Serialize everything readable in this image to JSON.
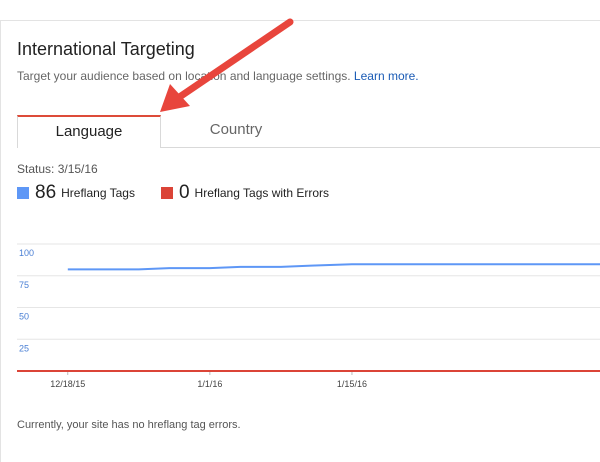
{
  "header": {
    "title": "International Targeting",
    "subtitle": "Target your audience based on location and language settings.",
    "learn_more": "Learn more."
  },
  "tabs": [
    {
      "label": "Language",
      "active": true
    },
    {
      "label": "Country",
      "active": false
    }
  ],
  "status": "Status: 3/15/16",
  "legend": [
    {
      "count": "86",
      "label": "Hreflang Tags",
      "color": "#5e97f6"
    },
    {
      "count": "0",
      "label": "Hreflang Tags with Errors",
      "color": "#db4437"
    }
  ],
  "chart_data": {
    "type": "line",
    "ylim": [
      0,
      100
    ],
    "yticks": [
      "100",
      "75",
      "50",
      "25"
    ],
    "xticks": [
      "12/18/15",
      "1/1/16",
      "1/15/16"
    ],
    "grid": true,
    "series": [
      {
        "name": "Hreflang Tags",
        "color": "#5e97f6",
        "x": [
          "12/18/15",
          "12/21/15",
          "12/25/15",
          "12/28/15",
          "1/1/16",
          "1/4/16",
          "1/8/16",
          "1/11/16",
          "1/15/16",
          "1/18/16",
          "1/22/16",
          "1/26/16"
        ],
        "values": [
          80,
          80,
          80,
          81,
          81,
          82,
          82,
          83,
          84,
          84,
          84,
          84
        ]
      },
      {
        "name": "Hreflang Tags with Errors",
        "color": "#db4437",
        "x": [
          "12/18/15",
          "1/26/16"
        ],
        "values": [
          0,
          0
        ]
      }
    ]
  },
  "footer": "Currently, your site has no hreflang tag errors.",
  "annotation": {
    "color": "#e8453c"
  }
}
